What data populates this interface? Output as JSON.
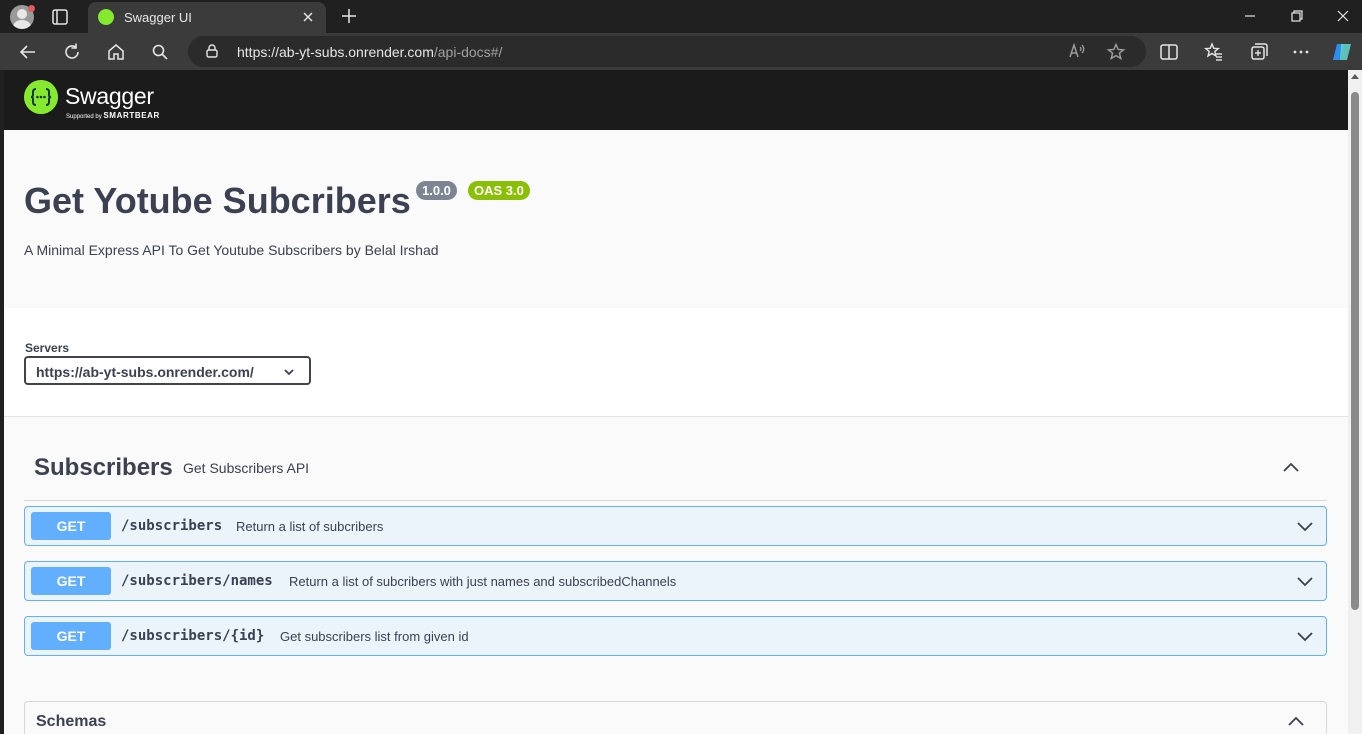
{
  "browser": {
    "tab_title": "Swagger UI",
    "url_host": "https://ab-yt-subs.onrender.com",
    "url_path": "/api-docs#/"
  },
  "swagger_header": {
    "logo_text": "Swagger",
    "logo_sub_prefix": "Supported by",
    "logo_sub_brand": "SMARTBEAR"
  },
  "info": {
    "title": "Get Yotube Subcribers",
    "version": "1.0.0",
    "oas": "OAS 3.0",
    "description": "A Minimal Express API To Get Youtube Subscribers by Belal Irshad"
  },
  "servers": {
    "label": "Servers",
    "selected": "https://ab-yt-subs.onrender.com/"
  },
  "tag": {
    "name": "Subscribers",
    "description": "Get Subscribers API"
  },
  "operations": [
    {
      "method": "GET",
      "path": "/subscribers",
      "summary": "Return a list of subcribers"
    },
    {
      "method": "GET",
      "path": "/subscribers/names",
      "summary": "Return a list of subcribers with just names and subscribedChannels"
    },
    {
      "method": "GET",
      "path": "/subscribers/{id}",
      "summary": "Get subscribers list from given id"
    }
  ],
  "schemas": {
    "title": "Schemas"
  },
  "colors": {
    "get_method": "#61affe",
    "get_background": "#ebf3fb",
    "oas_badge": "#89bf04",
    "version_badge": "#7d8492",
    "swagger_green": "#85ea2d",
    "text": "#3b4151"
  }
}
